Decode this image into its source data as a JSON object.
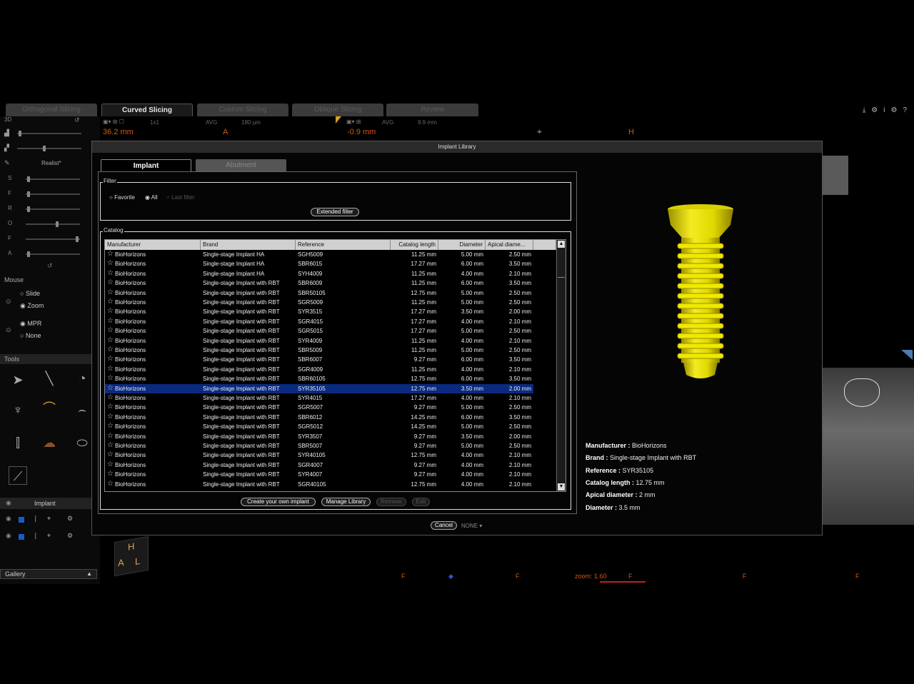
{
  "app": {
    "tabs": [
      {
        "label": "Orthogonal Slicing",
        "active": false
      },
      {
        "label": "Curved Slicing",
        "active": true
      },
      {
        "label": "Custom Slicing",
        "active": false
      },
      {
        "label": "Oblique Slicing",
        "active": false
      },
      {
        "label": "Review",
        "active": false
      }
    ],
    "top_icons": [
      "download-icon",
      "settings-icon",
      "info-icon",
      "gears-icon",
      "help-icon"
    ],
    "top_icon_glyphs": [
      "⤓",
      "⚙",
      "i",
      "⚙",
      "?"
    ],
    "viewport_left": {
      "avg_label": "AVG",
      "size_label": "1x1",
      "thickness": "180 µm",
      "measure": "36.2 mm",
      "orient": "A"
    },
    "viewport_right": {
      "avg_label": "AVG",
      "thickness": "9.9 mm",
      "measure": "-0.9 mm",
      "orient": "H"
    },
    "render_mode": "Realist*",
    "left_labels": [
      "3D",
      "S",
      "F",
      "R",
      "O",
      "F",
      "A"
    ],
    "mouse": {
      "title": "Mouse",
      "options1": [
        "Slide",
        "Zoom"
      ],
      "selected1": "Zoom",
      "options2": [
        "MPR",
        "None"
      ],
      "selected2": "MPR"
    },
    "tools_title": "Tools",
    "implant_header": "Implant",
    "gallery_label": "Gallery",
    "cube_letters": [
      "H",
      "A",
      "L"
    ],
    "bottom": {
      "zoom": "zoom: 1.60",
      "marks": [
        "F",
        "F",
        "F",
        "F",
        "F"
      ]
    }
  },
  "dialog": {
    "title": "Implant Library",
    "tabs": [
      {
        "label": "Implant",
        "active": true
      },
      {
        "label": "Abutment",
        "active": false
      }
    ],
    "filter": {
      "label": "Filter",
      "options": [
        "Favorite",
        "All",
        "Last filter"
      ],
      "selected": "All",
      "extended_button": "Extended filter"
    },
    "catalog": {
      "label": "Catalog",
      "columns": [
        "Manufacturer",
        "Brand",
        "Reference",
        "Catalog length",
        "Diameter",
        "Apical diame..."
      ],
      "selected_reference": "SYR35105",
      "rows": [
        [
          "BioHorizons",
          "Single-stage Implant HA",
          "SGH5009",
          "11.25 mm",
          "5.00 mm",
          "2.50 mm"
        ],
        [
          "BioHorizons",
          "Single-stage Implant HA",
          "SBR6015",
          "17.27 mm",
          "6.00 mm",
          "3.50 mm"
        ],
        [
          "BioHorizons",
          "Single-stage Implant HA",
          "SYH4009",
          "11.25 mm",
          "4.00 mm",
          "2.10 mm"
        ],
        [
          "BioHorizons",
          "Single-stage Implant with RBT",
          "SBR6009",
          "11.25 mm",
          "6.00 mm",
          "3.50 mm"
        ],
        [
          "BioHorizons",
          "Single-stage Implant with RBT",
          "SBR50105",
          "12.75 mm",
          "5.00 mm",
          "2.50 mm"
        ],
        [
          "BioHorizons",
          "Single-stage Implant with RBT",
          "SGR5009",
          "11.25 mm",
          "5.00 mm",
          "2.50 mm"
        ],
        [
          "BioHorizons",
          "Single-stage Implant with RBT",
          "SYR3515",
          "17.27 mm",
          "3.50 mm",
          "2.00 mm"
        ],
        [
          "BioHorizons",
          "Single-stage Implant with RBT",
          "SGR4015",
          "17.27 mm",
          "4.00 mm",
          "2.10 mm"
        ],
        [
          "BioHorizons",
          "Single-stage Implant with RBT",
          "SGR5015",
          "17.27 mm",
          "5.00 mm",
          "2.50 mm"
        ],
        [
          "BioHorizons",
          "Single-stage Implant with RBT",
          "SYR4009",
          "11.25 mm",
          "4.00 mm",
          "2.10 mm"
        ],
        [
          "BioHorizons",
          "Single-stage Implant with RBT",
          "SBR5009",
          "11.25 mm",
          "5.00 mm",
          "2.50 mm"
        ],
        [
          "BioHorizons",
          "Single-stage Implant with RBT",
          "SBR6007",
          "9.27 mm",
          "6.00 mm",
          "3.50 mm"
        ],
        [
          "BioHorizons",
          "Single-stage Implant with RBT",
          "SGR4009",
          "11.25 mm",
          "4.00 mm",
          "2.10 mm"
        ],
        [
          "BioHorizons",
          "Single-stage Implant with RBT",
          "SBR60105",
          "12.75 mm",
          "6.00 mm",
          "3.50 mm"
        ],
        [
          "BioHorizons",
          "Single-stage Implant with RBT",
          "SYR35105",
          "12.75 mm",
          "3.50 mm",
          "2.00 mm"
        ],
        [
          "BioHorizons",
          "Single-stage Implant with RBT",
          "SYR4015",
          "17.27 mm",
          "4.00 mm",
          "2.10 mm"
        ],
        [
          "BioHorizons",
          "Single-stage Implant with RBT",
          "SGR5007",
          "9.27 mm",
          "5.00 mm",
          "2.50 mm"
        ],
        [
          "BioHorizons",
          "Single-stage Implant with RBT",
          "SBR6012",
          "14.25 mm",
          "6.00 mm",
          "3.50 mm"
        ],
        [
          "BioHorizons",
          "Single-stage Implant with RBT",
          "SGR5012",
          "14.25 mm",
          "5.00 mm",
          "2.50 mm"
        ],
        [
          "BioHorizons",
          "Single-stage Implant with RBT",
          "SYR3507",
          "9.27 mm",
          "3.50 mm",
          "2.00 mm"
        ],
        [
          "BioHorizons",
          "Single-stage Implant with RBT",
          "SBR5007",
          "9.27 mm",
          "5.00 mm",
          "2.50 mm"
        ],
        [
          "BioHorizons",
          "Single-stage Implant with RBT",
          "SYR40105",
          "12.75 mm",
          "4.00 mm",
          "2.10 mm"
        ],
        [
          "BioHorizons",
          "Single-stage Implant with RBT",
          "SGR4007",
          "9.27 mm",
          "4.00 mm",
          "2.10 mm"
        ],
        [
          "BioHorizons",
          "Single-stage Implant with RBT",
          "SYR4007",
          "9.27 mm",
          "4.00 mm",
          "2.10 mm"
        ],
        [
          "BioHorizons",
          "Single-stage Implant with RBT",
          "SGR40105",
          "12.75 mm",
          "4.00 mm",
          "2.10 mm"
        ]
      ]
    },
    "buttons": {
      "create": "Create your own implant",
      "manage": "Manage Library",
      "remove": "Remove",
      "edit": "Edit",
      "cancel": "Cancel",
      "none_select": "NONE"
    },
    "details": {
      "manufacturer_label": "Manufacturer :",
      "manufacturer": "BioHorizons",
      "brand_label": "Brand :",
      "brand": "Single-stage Implant with RBT",
      "reference_label": "Reference :",
      "reference": "SYR35105",
      "length_label": "Catalog length :",
      "length": "12.75 mm",
      "apical_label": "Apical diameter :",
      "apical": "2 mm",
      "diameter_label": "Diameter :",
      "diameter": "3.5 mm"
    },
    "implant_color": "#f0e800"
  }
}
